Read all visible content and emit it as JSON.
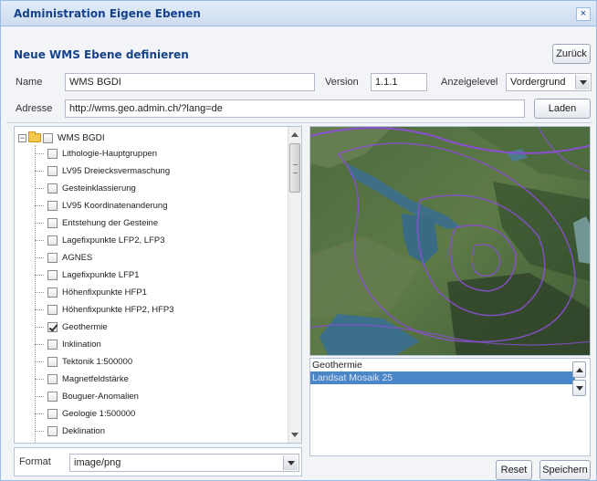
{
  "window": {
    "title": "Administration Eigene Ebenen",
    "close_label": "×"
  },
  "section": {
    "title": "Neue WMS Ebene definieren",
    "back_label": "Zurück"
  },
  "form": {
    "name_label": "Name",
    "name_value": "WMS BGDI",
    "version_label": "Version",
    "version_value": "1.1.1",
    "level_label": "Anzeigelevel",
    "level_value": "Vordergrund",
    "address_label": "Adresse",
    "address_value": "http://wms.geo.admin.ch/?lang=de",
    "load_label": "Laden",
    "format_label": "Format",
    "format_value": "image/png"
  },
  "tree": {
    "root_label": "WMS BGDI",
    "items": [
      {
        "label": "Lithologie-Hauptgruppen",
        "checked": false
      },
      {
        "label": "LV95 Dreiecksvermaschung",
        "checked": false
      },
      {
        "label": "Gesteinklassierung",
        "checked": false
      },
      {
        "label": "LV95 Koordinatenanderung",
        "checked": false
      },
      {
        "label": "Entstehung der Gesteine",
        "checked": false
      },
      {
        "label": "Lagefixpunkte LFP2, LFP3",
        "checked": false
      },
      {
        "label": "AGNES",
        "checked": false
      },
      {
        "label": "Lagefixpunkte LFP1",
        "checked": false
      },
      {
        "label": "Höhenfixpunkte HFP1",
        "checked": false
      },
      {
        "label": "Höhenfixpunkte HFP2, HFP3",
        "checked": false
      },
      {
        "label": "Geothermie",
        "checked": true
      },
      {
        "label": "Inklination",
        "checked": false
      },
      {
        "label": "Tektonik 1:500000",
        "checked": false
      },
      {
        "label": "Magnetfeldstärke",
        "checked": false
      },
      {
        "label": "Bouguer-Anomalien",
        "checked": false
      },
      {
        "label": "Geologie 1:500000",
        "checked": false
      },
      {
        "label": "Deklination",
        "checked": false
      }
    ]
  },
  "layers": {
    "items": [
      {
        "label": "Geothermie",
        "selected": false
      },
      {
        "label": "Landsat Mosaik 25",
        "selected": true
      }
    ]
  },
  "actions": {
    "reset_label": "Reset",
    "save_label": "Speichern"
  },
  "colors": {
    "accent": "#15428b",
    "border": "#99bbe8",
    "selection": "#4a86c8",
    "contour": "#8a4fd0"
  }
}
